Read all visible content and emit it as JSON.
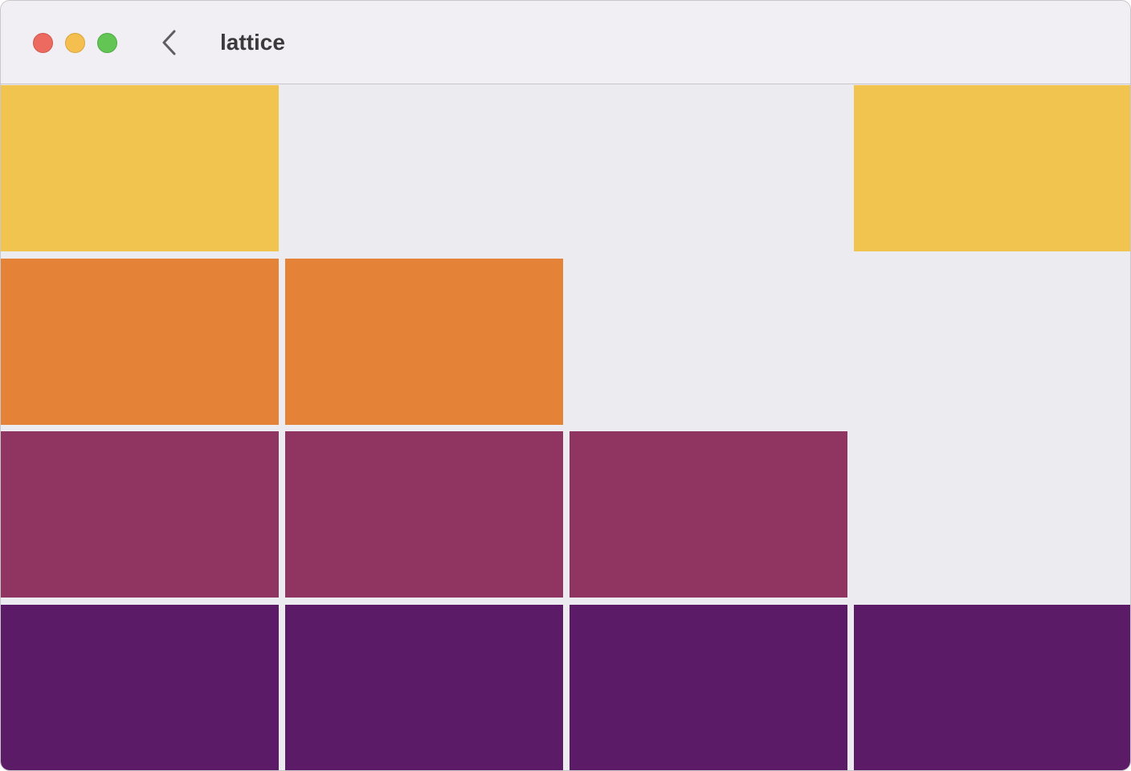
{
  "window": {
    "title": "lattice"
  },
  "controls": {
    "close": "close-button",
    "minimize": "minimize-button",
    "zoom": "zoom-button",
    "back_icon": "chevron-left-icon"
  },
  "colors": {
    "yellow": "#f0c44f",
    "orange": "#e48337",
    "magenta": "#903461",
    "purple": "#5c1b67",
    "background": "#ecebef"
  },
  "lattice": {
    "rows": [
      [
        "yellow",
        null,
        null,
        "yellow"
      ],
      [
        "orange",
        "orange",
        null,
        null
      ],
      [
        "magenta",
        "magenta",
        "magenta",
        null
      ],
      [
        "purple",
        "purple",
        "purple",
        "purple"
      ]
    ]
  }
}
